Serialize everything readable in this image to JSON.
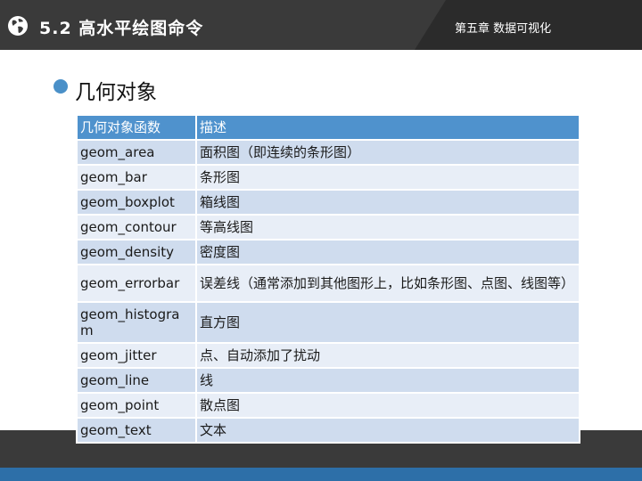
{
  "header": {
    "title": "5.2 高水平绘图命令",
    "chapter": "第五章 数据可视化"
  },
  "section": {
    "title": "几何对象"
  },
  "table": {
    "headers": [
      "几何对象函数",
      "描述"
    ],
    "rows": [
      {
        "func": "geom_area",
        "desc": "面积图（即连续的条形图）"
      },
      {
        "func": "geom_bar",
        "desc": "条形图"
      },
      {
        "func": "geom_boxplot",
        "desc": "箱线图"
      },
      {
        "func": "geom_contour",
        "desc": "等高线图"
      },
      {
        "func": "geom_density",
        "desc": "密度图"
      },
      {
        "func": "geom_errorbar",
        "desc": "误差线（通常添加到其他图形上，比如条形图、点图、线图等）"
      },
      {
        "func": "geom_histogram",
        "desc": "直方图"
      },
      {
        "func": "geom_jitter",
        "desc": "点、自动添加了扰动"
      },
      {
        "func": "geom_line",
        "desc": "线"
      },
      {
        "func": "geom_point",
        "desc": "散点图"
      },
      {
        "func": "geom_text",
        "desc": "文本"
      }
    ]
  },
  "colors": {
    "header_bg": "#3a3a3a",
    "accent": "#4f92cd",
    "row_dark": "#cfdcee",
    "row_light": "#e8eef7",
    "bottom_strip": "#2d6fa8"
  },
  "icons": {
    "header": "globe-icon",
    "bullet": "bullet-dot-icon"
  }
}
